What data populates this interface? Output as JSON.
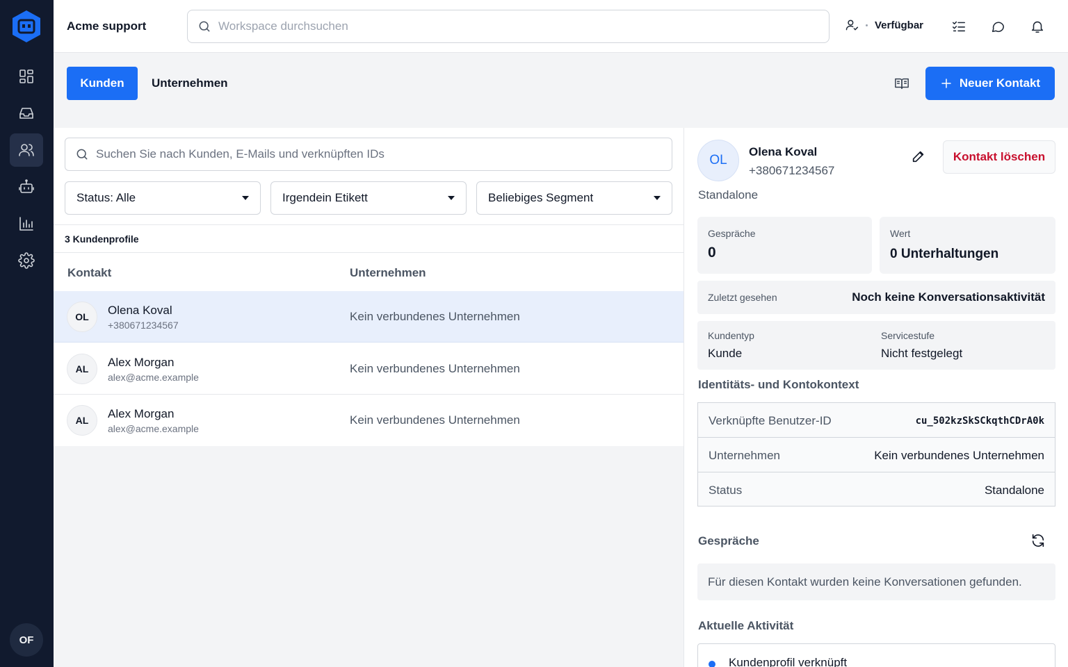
{
  "app": {
    "title": "Acme support",
    "user_initials": "OF"
  },
  "topbar": {
    "search_placeholder": "Workspace durchsuchen",
    "status": "Verfügbar"
  },
  "tabs": {
    "kunden": "Kunden",
    "unternehmen": "Unternehmen"
  },
  "actions": {
    "new_contact": "Neuer Kontakt"
  },
  "list": {
    "search_placeholder": "Suchen Sie nach Kunden, E-Mails und verknüpften IDs",
    "filters": [
      "Status: Alle",
      "Irgendein Etikett",
      "Beliebiges Segment"
    ],
    "count": "3 Kundenprofile",
    "columns": {
      "contact": "Kontakt",
      "company": "Unternehmen"
    },
    "rows": [
      {
        "initials": "OL",
        "name": "Olena Koval",
        "sub": "+380671234567",
        "company": "Kein verbundenes Unternehmen"
      },
      {
        "initials": "AL",
        "name": "Alex Morgan",
        "sub": "alex@acme.example",
        "company": "Kein verbundenes Unternehmen"
      },
      {
        "initials": "AL",
        "name": "Alex Morgan",
        "sub": "alex@acme.example",
        "company": "Kein verbundenes Unternehmen"
      }
    ]
  },
  "detail": {
    "initials": "OL",
    "name": "Olena Koval",
    "phone": "+380671234567",
    "delete_label": "Kontakt löschen",
    "type_tag": "Standalone",
    "stats": {
      "conversations_label": "Gespräche",
      "conversations_value": "0",
      "value_label": "Wert",
      "value_value": "0 Unterhaltungen"
    },
    "last_seen": {
      "label": "Zuletzt gesehen",
      "value": "Noch keine Konversationsaktivität"
    },
    "customer_type": {
      "label": "Kundentyp",
      "value": "Kunde"
    },
    "service_level": {
      "label": "Servicestufe",
      "value": "Nicht festgelegt"
    },
    "identity_title": "Identitäts- und Kontokontext",
    "identity": {
      "user_id_label": "Verknüpfte Benutzer-ID",
      "user_id_value": "cu_502kzSkSCkqthCDrA0k",
      "company_label": "Unternehmen",
      "company_value": "Kein verbundenes Unternehmen",
      "status_label": "Status",
      "status_value": "Standalone"
    },
    "conversations_title": "Gespräche",
    "conversations_empty": "Für diesen Kontakt wurden keine Konversationen gefunden.",
    "activity_title": "Aktuelle Aktivität",
    "activity_item": "Kundenprofil verknüpft"
  },
  "colors": {
    "accent": "#1b6ef5",
    "sidebar": "#111a2e",
    "danger": "#c8102e"
  }
}
